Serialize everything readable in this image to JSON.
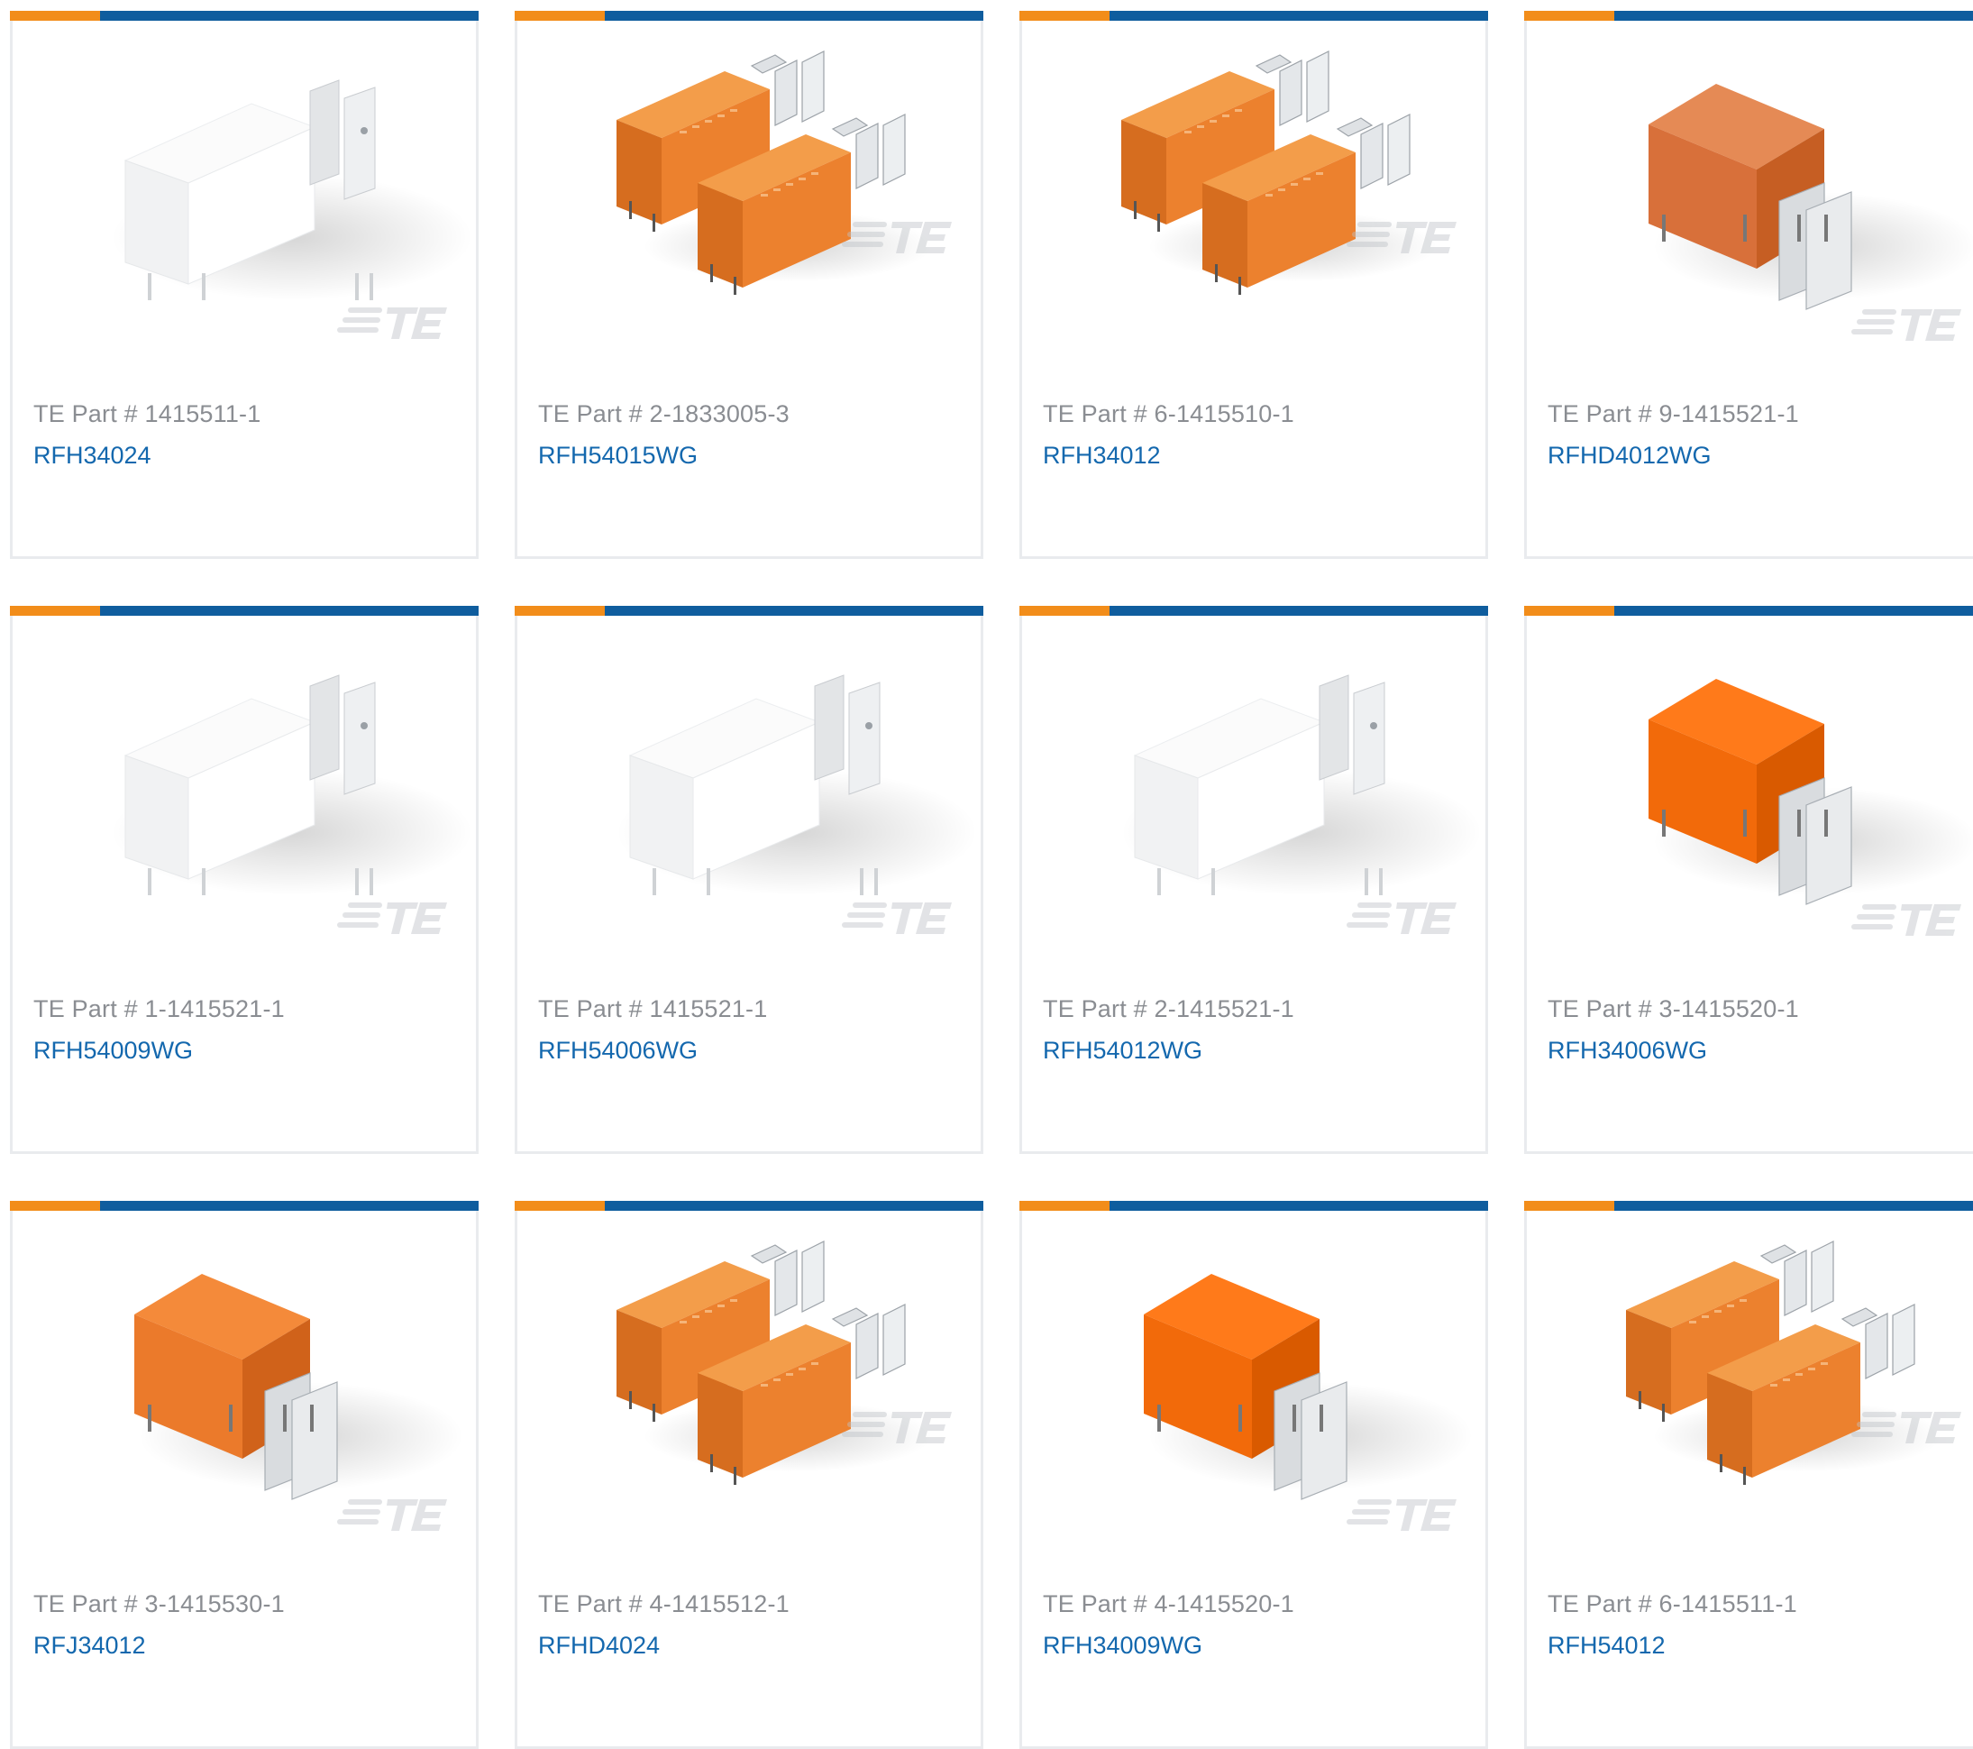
{
  "part_prefix": "TE Part #",
  "brand_colors": {
    "accent_orange": "#f28d1a",
    "accent_blue": "#0f5d9e",
    "link_blue": "#1468ae",
    "label_gray": "#8a8d92"
  },
  "products": [
    {
      "part_number": "1415511-1",
      "model": "RFH34024",
      "image": "relay-white-single"
    },
    {
      "part_number": "2-1833005-3",
      "model": "RFH54015WG",
      "image": "relay-orange-pair"
    },
    {
      "part_number": "6-1415510-1",
      "model": "RFH34012",
      "image": "relay-orange-pair"
    },
    {
      "part_number": "9-1415521-1",
      "model": "RFHD4012WG",
      "image": "relay-orange-single-dark"
    },
    {
      "part_number": "1-1415521-1",
      "model": "RFH54009WG",
      "image": "relay-white-single"
    },
    {
      "part_number": "1415521-1",
      "model": "RFH54006WG",
      "image": "relay-white-single"
    },
    {
      "part_number": "2-1415521-1",
      "model": "RFH54012WG",
      "image": "relay-white-single"
    },
    {
      "part_number": "3-1415520-1",
      "model": "RFH34006WG",
      "image": "relay-orange-single-bright"
    },
    {
      "part_number": "3-1415530-1",
      "model": "RFJ34012",
      "image": "relay-orange-single"
    },
    {
      "part_number": "4-1415512-1",
      "model": "RFHD4024",
      "image": "relay-orange-pair"
    },
    {
      "part_number": "4-1415520-1",
      "model": "RFH34009WG",
      "image": "relay-orange-single-bright"
    },
    {
      "part_number": "6-1415511-1",
      "model": "RFH54012",
      "image": "relay-orange-pair"
    }
  ]
}
